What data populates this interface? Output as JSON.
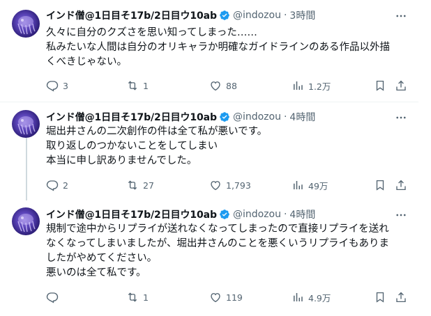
{
  "account": {
    "display_name": "インド僧@1日目そ17b/2日目ウ10ab",
    "handle": "@indozou",
    "separator": "·"
  },
  "tweets": [
    {
      "time": "3時間",
      "lines": [
        "久々に自分のクズさを思い知ってしまった……",
        "私みたいな人間は自分のオリキャラか明確なガイドラインのある作品以外描",
        "くべきじゃない。"
      ],
      "replies": "3",
      "retweets": "1",
      "likes": "88",
      "views": "1.2万"
    },
    {
      "time": "4時間",
      "lines": [
        "堀出井さんの二次創作の件は全て私が悪いです。",
        "取り返しのつかないことをしてしまい",
        "本当に申し訳ありませんでした。"
      ],
      "replies": "2",
      "retweets": "27",
      "likes": "1,793",
      "views": "49万"
    },
    {
      "time": "4時間",
      "lines": [
        "規制で途中からリプライが送れなくなってしまったので直接リプライを送れ",
        "なくなってしまいましたが、堀出井さんのことを悪くいうリプライもありま",
        "したがやめてください。",
        "悪いのは全て私です。"
      ],
      "replies": "",
      "retweets": "1",
      "likes": "119",
      "views": "4.9万"
    }
  ],
  "colors": {
    "text": "#0f1419",
    "secondary": "#536471",
    "verified": "#1d9bf0",
    "divider": "#eff3f4",
    "thread_line": "#cfd9de"
  },
  "icons": [
    "reply-icon",
    "retweet-icon",
    "like-icon",
    "views-icon",
    "bookmark-icon",
    "share-icon",
    "more-icon",
    "verified-icon"
  ]
}
